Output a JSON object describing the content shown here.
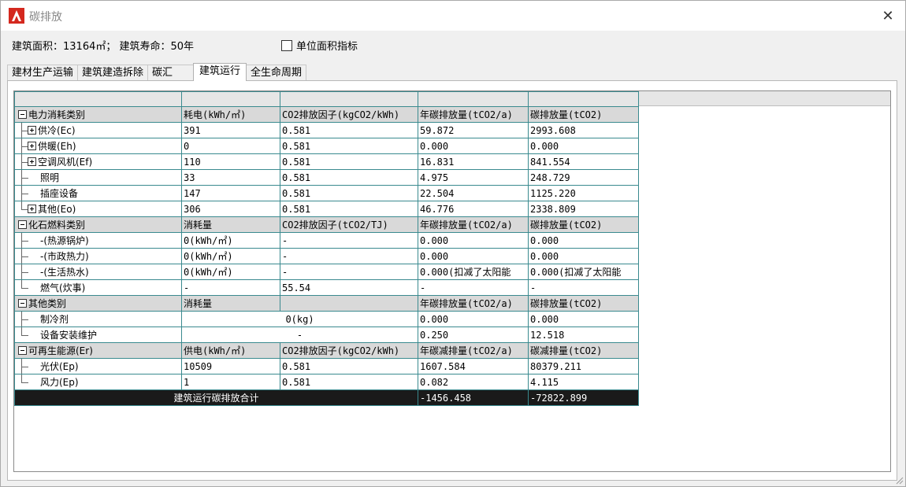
{
  "window": {
    "title": "碳排放",
    "close_glyph": "✕"
  },
  "info": {
    "text": "建筑面积：13164㎡； 建筑寿命：50年",
    "checkbox_label": "单位面积指标"
  },
  "tabs": [
    {
      "label": "建材生产运输"
    },
    {
      "label": "建筑建造拆除"
    },
    {
      "label": "碳汇"
    },
    {
      "label": "建筑运行"
    },
    {
      "label": "全生命周期"
    }
  ],
  "table": {
    "groups": {
      "electric": {
        "name": "电力消耗类别",
        "h1": "耗电(kWh/㎡)",
        "h2": "CO2排放因子(kgCO2/kWh)",
        "h3": "年碳排放量(tCO2/a)",
        "h4": "碳排放量(tCO2)",
        "rows": [
          {
            "name": "供冷(Ec)",
            "c1": "391",
            "c2": "0.581",
            "c3": "59.872",
            "c4": "2993.608"
          },
          {
            "name": "供暖(Eh)",
            "c1": "0",
            "c2": "0.581",
            "c3": "0.000",
            "c4": "0.000"
          },
          {
            "name": "空调风机(Ef)",
            "c1": "110",
            "c2": "0.581",
            "c3": "16.831",
            "c4": "841.554"
          },
          {
            "name": "照明",
            "c1": "33",
            "c2": "0.581",
            "c3": "4.975",
            "c4": "248.729"
          },
          {
            "name": "插座设备",
            "c1": "147",
            "c2": "0.581",
            "c3": "22.504",
            "c4": "1125.220"
          },
          {
            "name": "其他(Eo)",
            "c1": "306",
            "c2": "0.581",
            "c3": "46.776",
            "c4": "2338.809"
          }
        ]
      },
      "fossil": {
        "name": "化石燃料类别",
        "h1": "消耗量",
        "h2": "CO2排放因子(tCO2/TJ)",
        "h3": "年碳排放量(tCO2/a)",
        "h4": "碳排放量(tCO2)",
        "rows": [
          {
            "name": "-(热源锅炉)",
            "c1": "0(kWh/㎡)",
            "c2": "-",
            "c3": "0.000",
            "c4": "0.000"
          },
          {
            "name": "-(市政热力)",
            "c1": "0(kWh/㎡)",
            "c2": "-",
            "c3": "0.000",
            "c4": "0.000"
          },
          {
            "name": "-(生活热水)",
            "c1": "0(kWh/㎡)",
            "c2": "-",
            "c3": "0.000(扣减了太阳能",
            "c4": "0.000(扣减了太阳能"
          },
          {
            "name": "燃气(炊事)",
            "c1": "-",
            "c2": "55.54",
            "c3": "-",
            "c4": "-"
          }
        ]
      },
      "other": {
        "name": "其他类别",
        "h1": "消耗量",
        "h3": "年碳排放量(tCO2/a)",
        "h4": "碳排放量(tCO2)",
        "rows": [
          {
            "name": "制冷剂",
            "c12": "0(kg)",
            "c3": "0.000",
            "c4": "0.000"
          },
          {
            "name": "设备安装维护",
            "c12": "-",
            "c3": "0.250",
            "c4": "12.518"
          }
        ]
      },
      "renew": {
        "name": "可再生能源(Er)",
        "h1": "供电(kWh/㎡)",
        "h2": "CO2排放因子(kgCO2/kWh)",
        "h3": "年碳减排量(tCO2/a)",
        "h4": "碳减排量(tCO2)",
        "rows": [
          {
            "name": "光伏(Ep)",
            "c1": "10509",
            "c2": "0.581",
            "c3": "1607.584",
            "c4": "80379.211"
          },
          {
            "name": "风力(Ep)",
            "c1": "1",
            "c2": "0.581",
            "c3": "0.082",
            "c4": "4.115"
          }
        ]
      }
    },
    "total": {
      "label": "建筑运行碳排放合计",
      "annual": "-1456.458",
      "total": "-72822.899"
    }
  },
  "colors": {
    "grid_line": "#3a8a8f",
    "category_bg": "#d9d9d9",
    "total_bg": "#1a1a1a",
    "logo_red": "#d4281e"
  }
}
